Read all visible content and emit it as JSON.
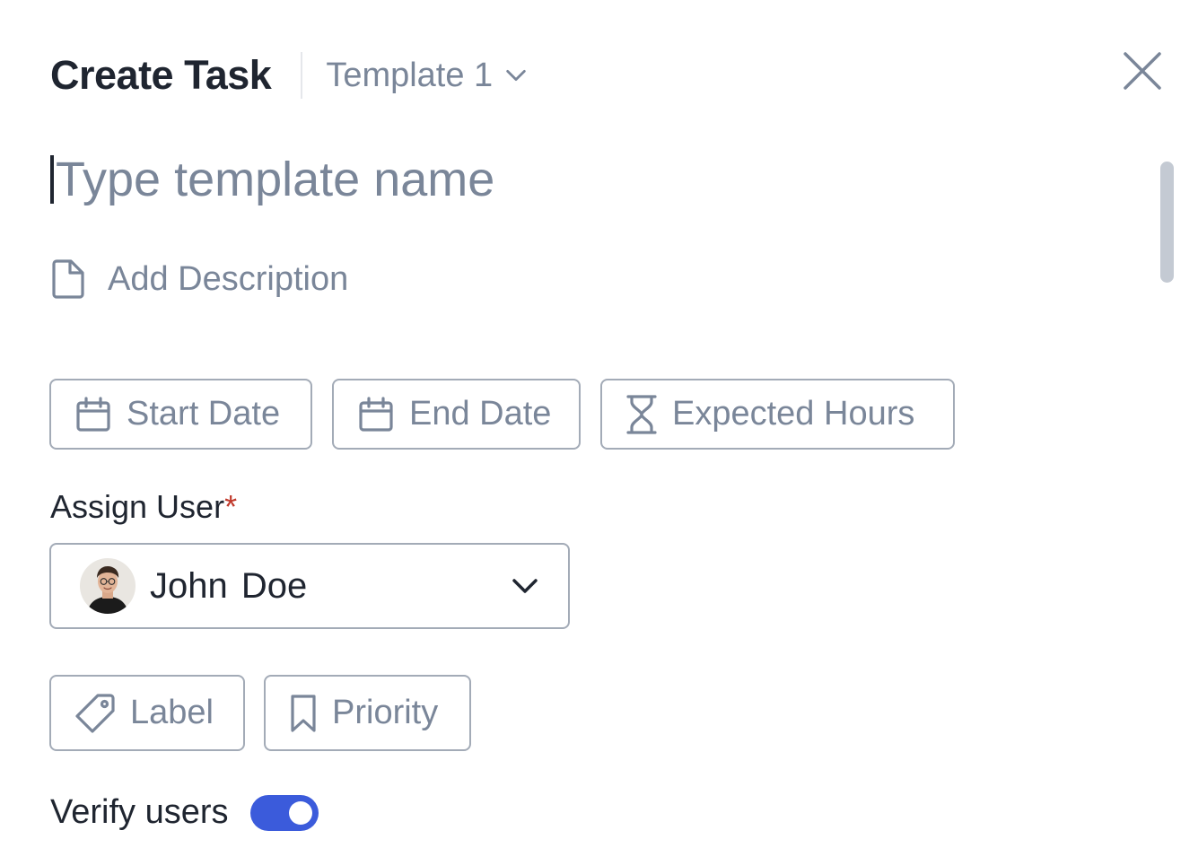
{
  "header": {
    "title": "Create Task",
    "template_select": {
      "value": "Template 1",
      "icon": "chevron-down-icon"
    },
    "close_icon": "close-icon"
  },
  "task_name": {
    "placeholder": "Type template name",
    "value": ""
  },
  "description": {
    "label": "Add Description",
    "icon": "document-icon"
  },
  "date_buttons": [
    {
      "label": "Start Date",
      "icon": "calendar-icon"
    },
    {
      "label": "End Date",
      "icon": "calendar-icon"
    },
    {
      "label": "Expected Hours",
      "icon": "hourglass-icon"
    }
  ],
  "assign_user": {
    "label": "Assign User",
    "required_marker": "*",
    "selected_user": "John Doe",
    "avatar": "avatar-icon",
    "icon": "chevron-down-icon"
  },
  "meta_buttons": [
    {
      "label": "Label",
      "icon": "tag-icon"
    },
    {
      "label": "Priority",
      "icon": "bookmark-icon"
    }
  ],
  "verify_users": {
    "label": "Verify users",
    "enabled": true
  },
  "colors": {
    "accent": "#3b5bdb",
    "text_primary": "#1f2530",
    "text_muted": "#7a8699",
    "border": "#a3abb7",
    "required": "#c0392b"
  }
}
